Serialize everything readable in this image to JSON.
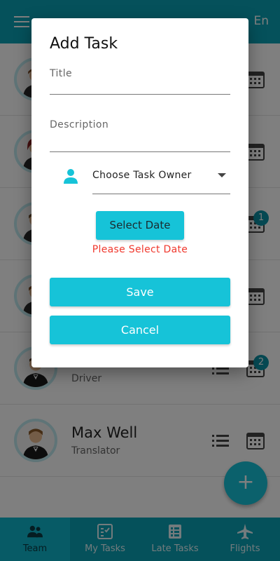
{
  "appbar": {
    "language": "En",
    "menu_icon": "hamburger-icon"
  },
  "team": [
    {
      "name": "",
      "role": "",
      "badge": ""
    },
    {
      "name": "",
      "role": "",
      "badge": ""
    },
    {
      "name": "",
      "role": "",
      "badge": "1"
    },
    {
      "name": "",
      "role": "",
      "badge": ""
    },
    {
      "name": "",
      "role": "Driver",
      "badge": "2"
    },
    {
      "name": "Max Well",
      "role": "Translator",
      "badge": ""
    }
  ],
  "fab": {
    "label": "+"
  },
  "bottom_nav": [
    {
      "label": "Team",
      "icon": "team-icon",
      "active": true
    },
    {
      "label": "My Tasks",
      "icon": "my-tasks-icon",
      "active": false
    },
    {
      "label": "Late Tasks",
      "icon": "late-tasks-icon",
      "active": false
    },
    {
      "label": "Flights",
      "icon": "flights-icon",
      "active": false
    }
  ],
  "dialog": {
    "title": "Add Task",
    "title_field_label": "Title",
    "description_field_label": "Description",
    "owner_placeholder": "Choose Task Owner",
    "select_date_label": "Select Date",
    "date_error": "Please Select Date",
    "save_label": "Save",
    "cancel_label": "Cancel"
  },
  "colors": {
    "primary": "#0aa3b6",
    "accent": "#16c3d8",
    "error": "#f0382d"
  }
}
